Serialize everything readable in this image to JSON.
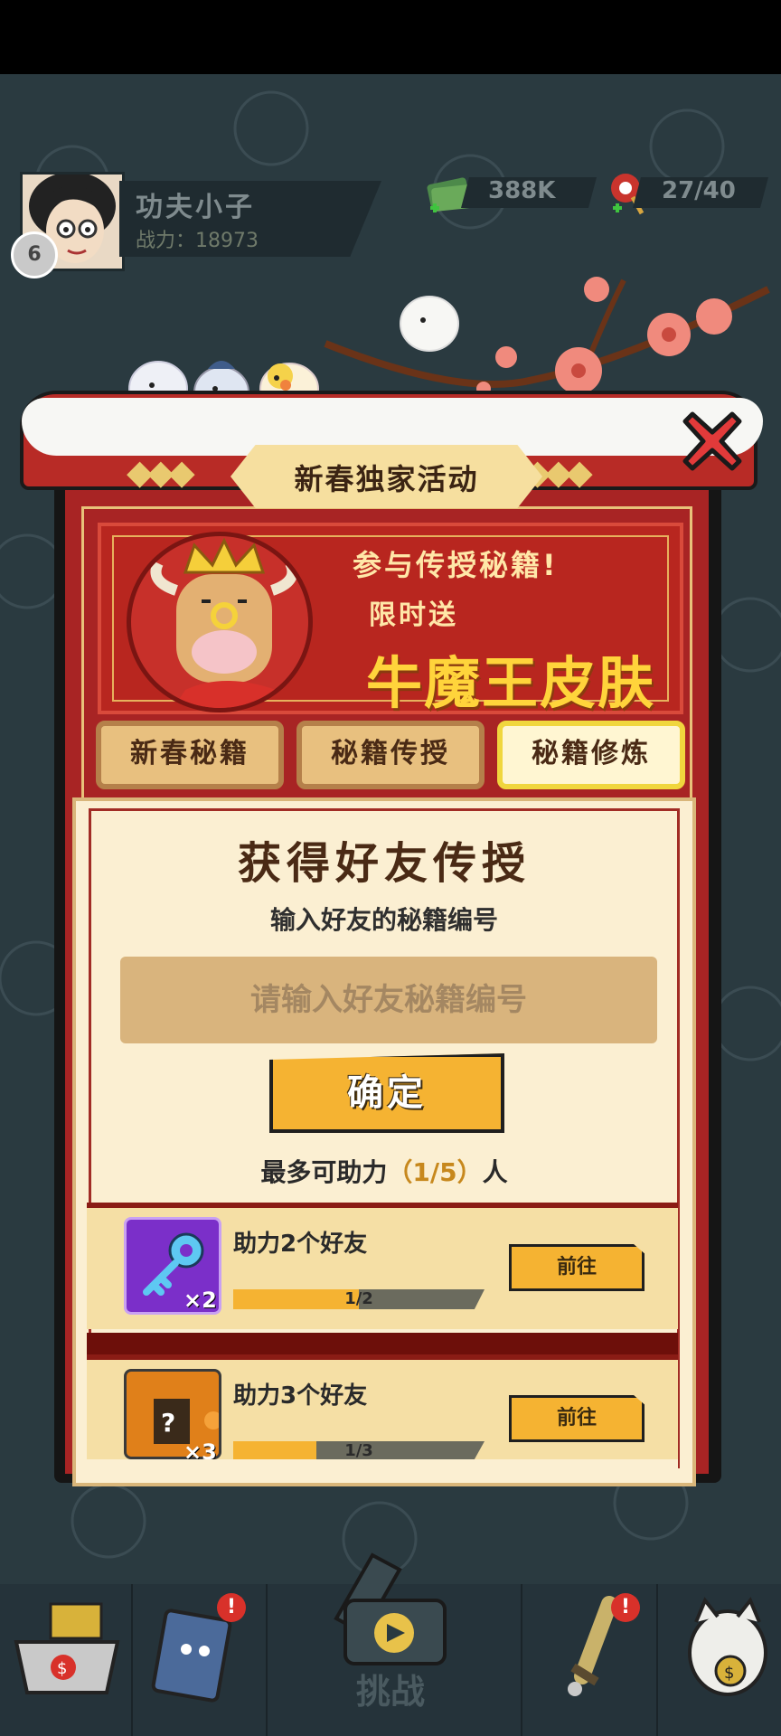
{
  "player": {
    "name": "功夫小子",
    "power": "战力：18973",
    "level": "6"
  },
  "resources": {
    "cash": "388K",
    "stamina": "27/40"
  },
  "modal": {
    "title": "新春独家活动",
    "banner": {
      "line1": "参与传授秘籍!",
      "line2": "限时送",
      "line3": "牛魔王皮肤"
    },
    "tabs": [
      {
        "label": "新春秘籍",
        "active": false
      },
      {
        "label": "秘籍传授",
        "active": false
      },
      {
        "label": "秘籍修炼",
        "active": true
      }
    ],
    "content": {
      "heading": "获得好友传授",
      "subheading": "输入好友的秘籍编号",
      "input_placeholder": "请输入好友秘籍编号",
      "confirm_label": "确定",
      "limit_prefix": "最多可助力",
      "limit_value": "（1/5）",
      "limit_suffix": "人"
    },
    "tasks": [
      {
        "label": "助力2个好友",
        "reward_count": "×2",
        "progress_text": "1/2",
        "progress": 0.5,
        "button": "前往"
      },
      {
        "label": "助力3个好友",
        "reward_count": "×3",
        "progress_text": "1/3",
        "progress": 0.33,
        "button": "前往"
      }
    ]
  },
  "nav": {
    "challenge_label": "挑战",
    "badge": "!"
  },
  "colors": {
    "background": "#2a3a40",
    "modal_red": "#a82424",
    "accent_yellow": "#f5b332",
    "content_bg": "#fbefd2"
  }
}
